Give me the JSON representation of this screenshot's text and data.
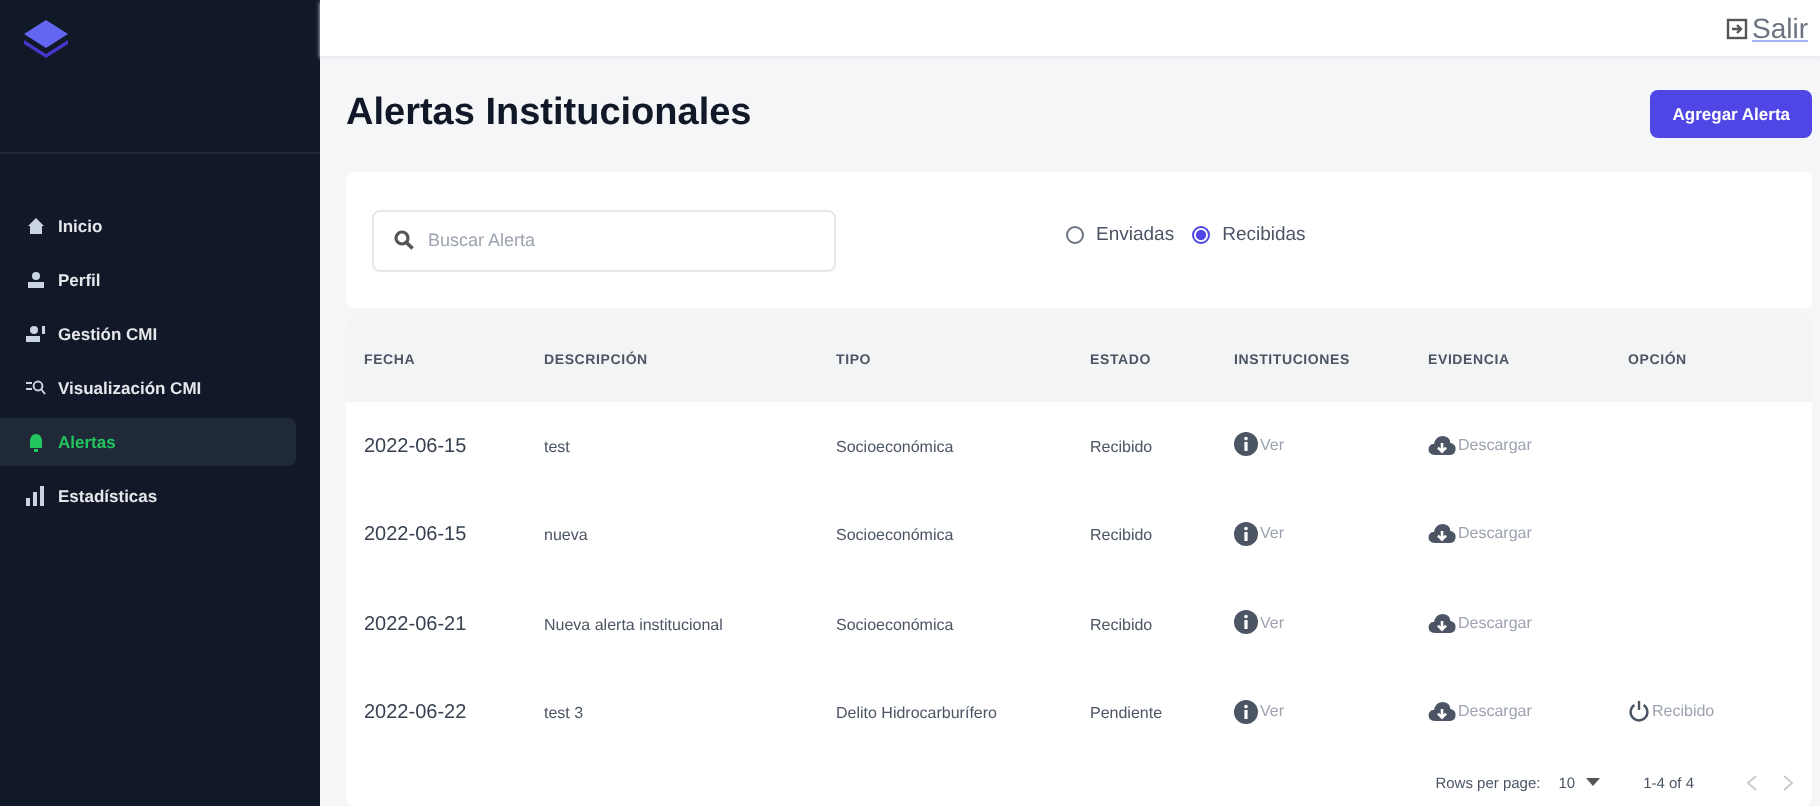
{
  "sidebar": {
    "items": [
      {
        "label": "Inicio",
        "kind": "home",
        "selected": false
      },
      {
        "label": "Perfil",
        "kind": "user",
        "selected": false
      },
      {
        "label": "Gestión CMI",
        "kind": "users",
        "selected": false
      },
      {
        "label": "Visualización CMI",
        "kind": "search",
        "selected": false
      },
      {
        "label": "Alertas",
        "kind": "bell",
        "selected": true
      },
      {
        "label": "Estadísticas",
        "kind": "chart",
        "selected": false
      }
    ]
  },
  "topbar": {
    "logout": "Salir"
  },
  "page": {
    "title": "Alertas Institucionales",
    "add_button": "Agregar Alerta"
  },
  "filters": {
    "search": {
      "placeholder": "Buscar Alerta"
    },
    "radios": [
      {
        "label": "Enviadas",
        "selected": false
      },
      {
        "label": "Recibidas",
        "selected": true
      }
    ]
  },
  "table": {
    "columns": [
      "FECHA",
      "DESCRIPCIÓN",
      "TIPO",
      "ESTADO",
      "INSTITUCIONES",
      "EVIDENCIA",
      "OPCIÓN"
    ],
    "rows": [
      {
        "fecha": "2022-06-15",
        "descripcion": "test",
        "tipo": "Socioeconómica",
        "estado": "Recibido",
        "instituciones": "Ver",
        "evidencia": "Descargar"
      },
      {
        "fecha": "2022-06-15",
        "descripcion": "nueva",
        "tipo": "Socioeconómica",
        "estado": "Recibido",
        "instituciones": "Ver",
        "evidencia": "Descargar"
      },
      {
        "fecha": "2022-06-21",
        "descripcion": "Nueva alerta institucional",
        "tipo": "Socioeconómica",
        "estado": "Recibido",
        "instituciones": "Ver",
        "evidencia": "Descargar"
      },
      {
        "fecha": "2022-06-22",
        "descripcion": "test 3",
        "tipo": "Delito Hidrocarburífero",
        "estado": "Pendiente",
        "instituciones": "Ver",
        "evidencia": "Descargar",
        "opcion": "Recibido"
      }
    ]
  },
  "pagination": {
    "rows_label": "Rows per page:",
    "rows_value": "10",
    "range": "1-4 of 4"
  }
}
